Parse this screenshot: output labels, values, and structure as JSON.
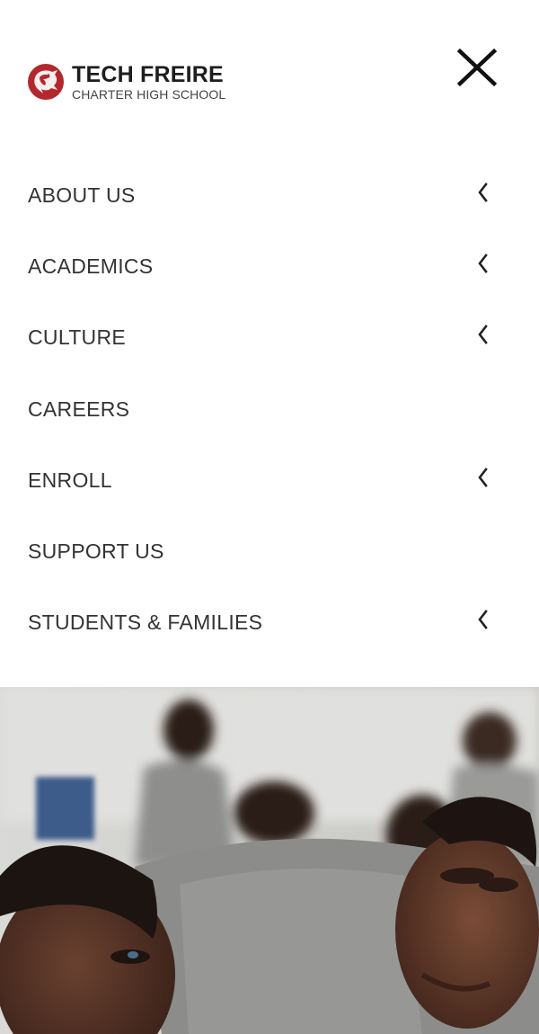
{
  "brand": {
    "title": "TECH FREIRE",
    "subtitle": "CHARTER HIGH SCHOOL",
    "color": "#b3282d"
  },
  "close": {
    "icon": "close-icon"
  },
  "nav": {
    "items": [
      {
        "label": "ABOUT US",
        "has_submenu": true
      },
      {
        "label": "ACADEMICS",
        "has_submenu": true
      },
      {
        "label": "CULTURE",
        "has_submenu": true
      },
      {
        "label": "CAREERS",
        "has_submenu": false
      },
      {
        "label": "ENROLL",
        "has_submenu": true
      },
      {
        "label": "SUPPORT US",
        "has_submenu": false
      },
      {
        "label": "STUDENTS & FAMILIES",
        "has_submenu": true
      }
    ],
    "chevron_icon": "chevron-left-icon",
    "text_color": "#333333"
  },
  "hero": {
    "image": "students-classroom-photo"
  }
}
